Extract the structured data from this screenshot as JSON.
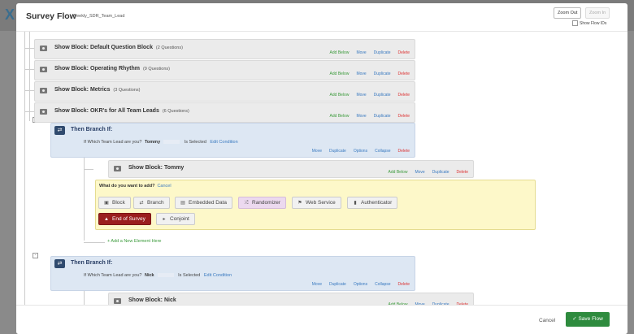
{
  "header": {
    "title": "Survey Flow",
    "subtitle": "Weekly_SDR_Team_Lead",
    "zoom_out": "Zoom Out",
    "zoom_in": "Zoom In",
    "show_flow_ids": "Show Flow IDs"
  },
  "blocks": [
    {
      "title": "Show Block: Default Question Block",
      "count": "(2 Questions)"
    },
    {
      "title": "Show Block: Operating Rhythm",
      "count": "(9 Questions)"
    },
    {
      "title": "Show Block: Metrics",
      "count": "(3 Questions)"
    },
    {
      "title": "Show Block: OKR's for All Team Leads",
      "count": "(6 Questions)"
    }
  ],
  "block_actions": {
    "add_below": "Add Below",
    "move": "Move",
    "duplicate": "Duplicate",
    "delete": "Delete"
  },
  "branches": [
    {
      "title": "Then Branch If:",
      "cond_prefix": "If",
      "question": "Which Team Lead are you?",
      "answer": "Tommy",
      "selected": "Is Selected",
      "edit": "Edit Condition",
      "inner_block": "Show Block: Tommy"
    },
    {
      "title": "Then Branch If:",
      "cond_prefix": "If",
      "question": "Which Team Lead are you?",
      "answer": "Nick",
      "selected": "Is Selected",
      "edit": "Edit Condition",
      "inner_block": "Show Block: Nick"
    }
  ],
  "branch_actions": {
    "move": "Move",
    "duplicate": "Duplicate",
    "options": "Options",
    "collapse": "Collapse",
    "delete": "Delete"
  },
  "add_panel": {
    "question": "What do you want to add?",
    "cancel": "Cancel",
    "options": [
      {
        "label": "Block",
        "icon": "block-icon"
      },
      {
        "label": "Branch",
        "icon": "branch-icon"
      },
      {
        "label": "Embedded Data",
        "icon": "embedded-data-icon"
      },
      {
        "label": "Randomizer",
        "icon": "randomizer-icon"
      },
      {
        "label": "Web Service",
        "icon": "web-service-icon"
      },
      {
        "label": "Authenticator",
        "icon": "lock-icon"
      },
      {
        "label": "End of Survey",
        "icon": "warning-icon"
      },
      {
        "label": "Conjoint",
        "icon": "conjoint-icon"
      }
    ]
  },
  "add_new_element": "+ Add a New Element Here",
  "footer": {
    "cancel": "Cancel",
    "save": "Save Flow"
  },
  "colors": {
    "save": "#2e8b3e",
    "branch_bg": "#dde7f3",
    "add_panel_bg": "#fdf8c9",
    "end_of_survey": "#9a1e1e",
    "randomizer": "#ecd9ef"
  }
}
